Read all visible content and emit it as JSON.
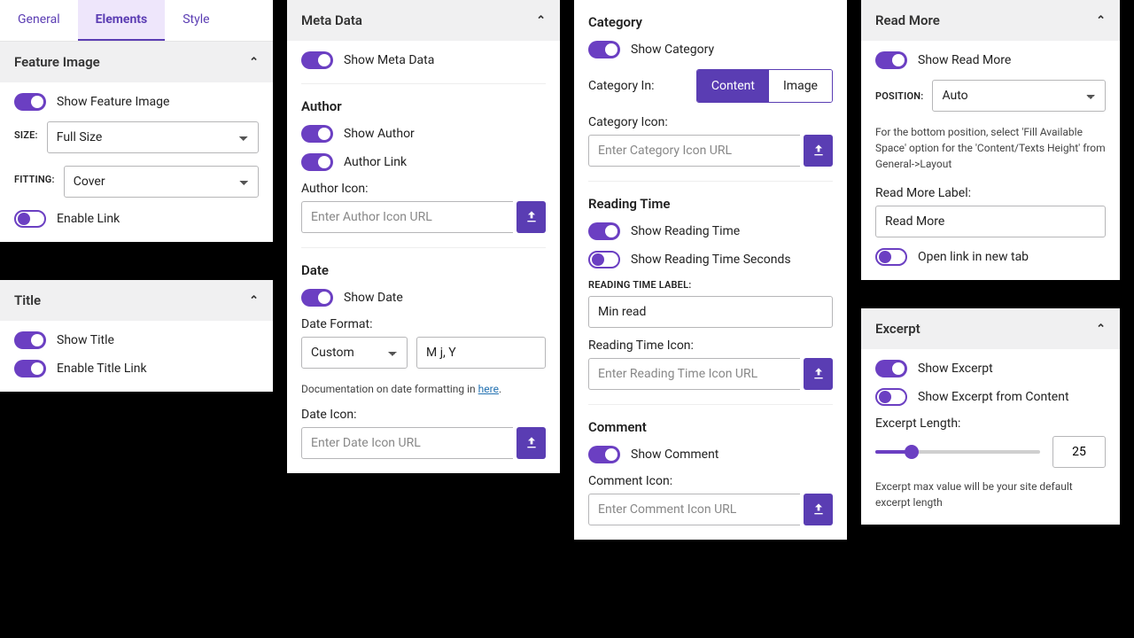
{
  "tabs": {
    "general": "General",
    "elements": "Elements",
    "style": "Style"
  },
  "featureImage": {
    "header": "Feature Image",
    "showFI": "Show Feature Image",
    "sizeLabel": "SIZE:",
    "sizeValue": "Full Size",
    "fittingLabel": "FITTING:",
    "fittingValue": "Cover",
    "enableLink": "Enable Link"
  },
  "title": {
    "header": "Title",
    "showTitle": "Show Title",
    "enableTitleLink": "Enable Title Link"
  },
  "metaData": {
    "header": "Meta Data",
    "showMeta": "Show Meta Data",
    "author": {
      "hdr": "Author",
      "showAuthor": "Show Author",
      "authorLink": "Author Link",
      "iconLabel": "Author Icon:",
      "iconPH": "Enter Author Icon URL"
    },
    "date": {
      "hdr": "Date",
      "showDate": "Show Date",
      "formatLabel": "Date Format:",
      "formatValue": "Custom",
      "customFormat": "M j, Y",
      "docText": "Documentation on date formatting in ",
      "docLink": "here",
      "docDot": ".",
      "iconLabel": "Date Icon:",
      "iconPH": "Enter Date Icon URL"
    }
  },
  "category": {
    "header": "Category",
    "showCategory": "Show Category",
    "categoryInLabel": "Category In:",
    "optContent": "Content",
    "optImage": "Image",
    "iconLabel": "Category Icon:",
    "iconPH": "Enter Category Icon URL"
  },
  "readingTime": {
    "header": "Reading Time",
    "show": "Show Reading Time",
    "showSeconds": "Show Reading Time Seconds",
    "labelLabel": "READING TIME LABEL:",
    "labelValue": "Min read",
    "iconLabel": "Reading Time Icon:",
    "iconPH": "Enter Reading Time Icon URL"
  },
  "comment": {
    "header": "Comment",
    "show": "Show Comment",
    "iconLabel": "Comment Icon:",
    "iconPH": "Enter Comment Icon URL"
  },
  "readMore": {
    "header": "Read More",
    "show": "Show Read More",
    "positionLabel": "POSITION:",
    "positionValue": "Auto",
    "help": "For the bottom position, select 'Fill Available Space' option for the 'Content/Texts Height' from General->Layout",
    "labelLabel": "Read More Label:",
    "labelValue": "Read More",
    "openNewTab": "Open link in new tab"
  },
  "excerpt": {
    "header": "Excerpt",
    "show": "Show Excerpt",
    "fromContent": "Show Excerpt from Content",
    "lenLabel": "Excerpt Length:",
    "lenValue": "25",
    "help": "Excerpt max value will be your site default excerpt length"
  }
}
